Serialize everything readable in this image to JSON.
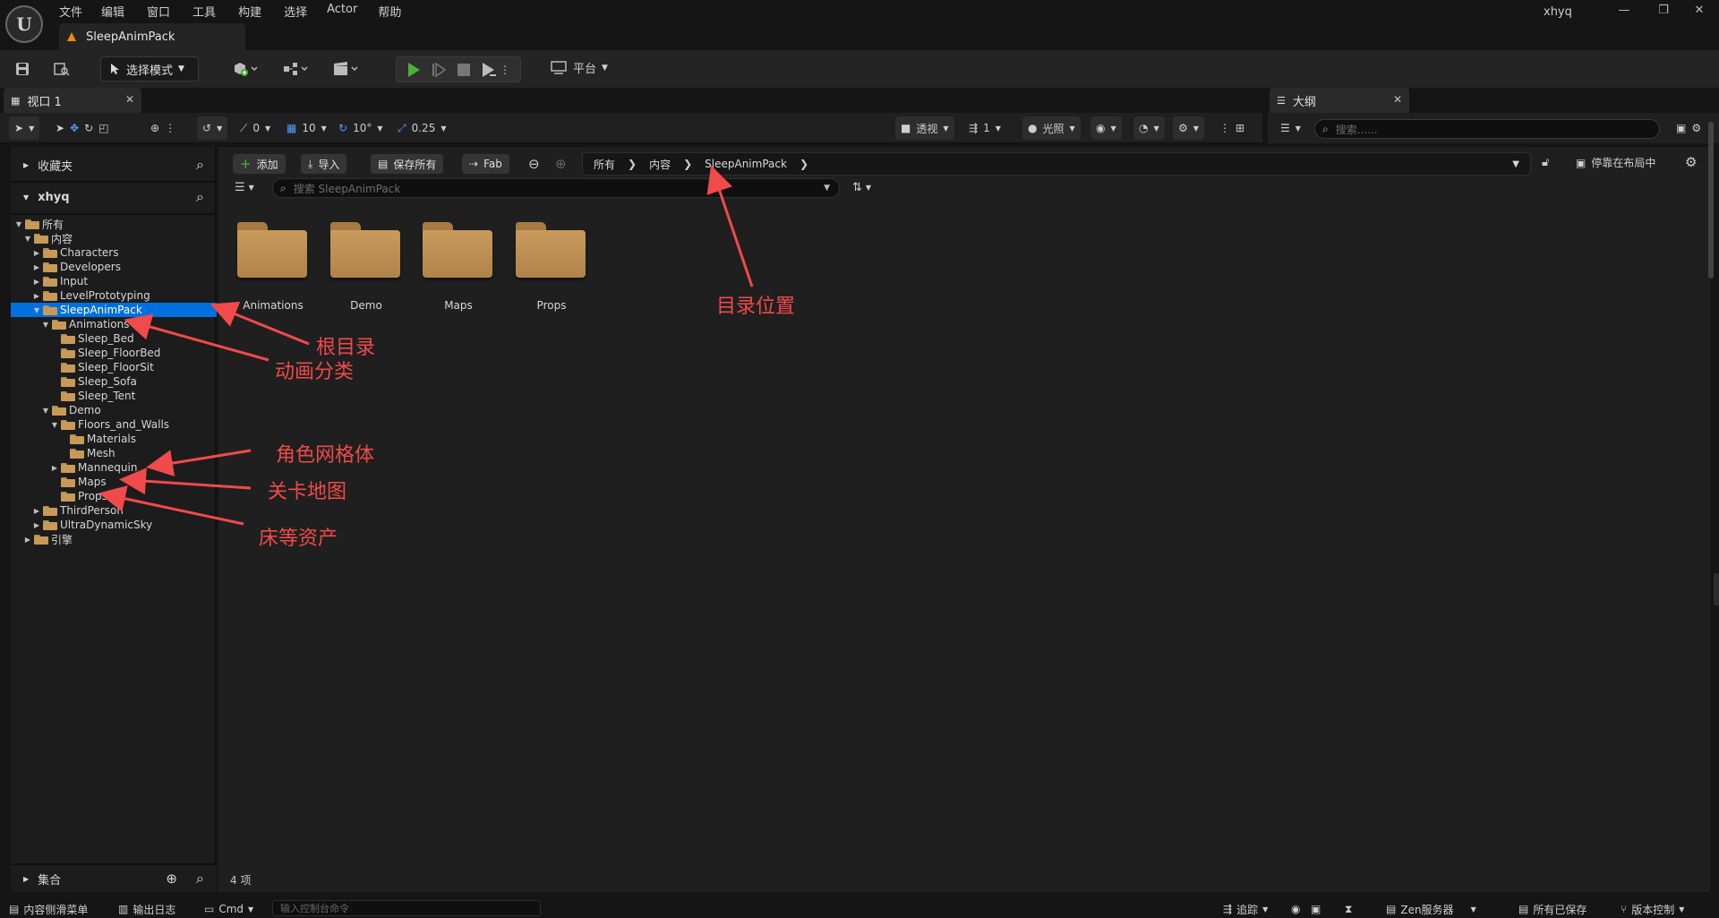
{
  "menu": [
    "文件",
    "编辑",
    "窗口",
    "工具",
    "构建",
    "选择",
    "Actor",
    "帮助"
  ],
  "doc_tab": "SleepAnimPack",
  "user": "xhyq",
  "toolbar": {
    "mode": "选择模式",
    "platform": "平台"
  },
  "panels": {
    "viewport_tab": "视口 1",
    "outliner_tab": "大纲",
    "outliner_search_placeholder": "搜索......"
  },
  "viewport_toolbar": {
    "rot_snap": "0",
    "grid_snap": "10",
    "angle_snap": "10°",
    "scale_snap": "0.25",
    "perspective": "透视",
    "cam_speed": "1",
    "lighting": "光照"
  },
  "content_browser": {
    "favorites": "收藏夹",
    "project": "xhyq",
    "collections": "集合",
    "tree": [
      {
        "label": "所有",
        "depth": 0,
        "caret": "▼",
        "open": true
      },
      {
        "label": "内容",
        "depth": 1,
        "caret": "▼",
        "open": true
      },
      {
        "label": "Characters",
        "depth": 2,
        "caret": "▶"
      },
      {
        "label": "Developers",
        "depth": 2,
        "caret": "▶"
      },
      {
        "label": "Input",
        "depth": 2,
        "caret": "▶"
      },
      {
        "label": "LevelPrototyping",
        "depth": 2,
        "caret": "▶"
      },
      {
        "label": "SleepAnimPack",
        "depth": 2,
        "caret": "▼",
        "selected": true,
        "open": true
      },
      {
        "label": "Animations",
        "depth": 3,
        "caret": "▼",
        "open": true
      },
      {
        "label": "Sleep_Bed",
        "depth": 4,
        "caret": ""
      },
      {
        "label": "Sleep_FloorBed",
        "depth": 4,
        "caret": ""
      },
      {
        "label": "Sleep_FloorSit",
        "depth": 4,
        "caret": ""
      },
      {
        "label": "Sleep_Sofa",
        "depth": 4,
        "caret": ""
      },
      {
        "label": "Sleep_Tent",
        "depth": 4,
        "caret": ""
      },
      {
        "label": "Demo",
        "depth": 3,
        "caret": "▼",
        "open": true
      },
      {
        "label": "Floors_and_Walls",
        "depth": 4,
        "caret": "▼",
        "open": true
      },
      {
        "label": "Materials",
        "depth": 5,
        "caret": ""
      },
      {
        "label": "Mesh",
        "depth": 5,
        "caret": ""
      },
      {
        "label": "Mannequin",
        "depth": 4,
        "caret": "▶"
      },
      {
        "label": "Maps",
        "depth": 4,
        "caret": ""
      },
      {
        "label": "Props",
        "depth": 4,
        "caret": ""
      },
      {
        "label": "ThirdPerson",
        "depth": 2,
        "caret": "▶"
      },
      {
        "label": "UltraDynamicSky",
        "depth": 2,
        "caret": "▶"
      },
      {
        "label": "引擎",
        "depth": 1,
        "caret": "▶"
      }
    ],
    "buttons": {
      "add": "添加",
      "import": "导入",
      "save_all": "保存所有",
      "fab": "Fab"
    },
    "breadcrumb": [
      "所有",
      "内容",
      "SleepAnimPack"
    ],
    "search_placeholder": "搜索 SleepAnimPack",
    "dock_label": "停靠在布局中",
    "folders": [
      "Animations",
      "Demo",
      "Maps",
      "Props"
    ],
    "item_count": "4 项"
  },
  "annotations": {
    "root_dir": "根目录",
    "anim_category": "动画分类",
    "char_mesh": "角色网格体",
    "level_map": "关卡地图",
    "bed_assets": "床等资产",
    "dir_location": "目录位置"
  },
  "statusbar": {
    "content_drawer": "内容侧滑菜单",
    "output_log": "输出日志",
    "cmd": "Cmd",
    "cmd_placeholder": "输入控制台命令",
    "trace": "追踪",
    "zen": "Zen服务器",
    "saved": "所有已保存",
    "source_control": "版本控制"
  },
  "colors": {
    "selection": "#0070e0",
    "annotation": "#f04a4a",
    "play_green": "#4caf3a",
    "folder": "#c89a58"
  }
}
